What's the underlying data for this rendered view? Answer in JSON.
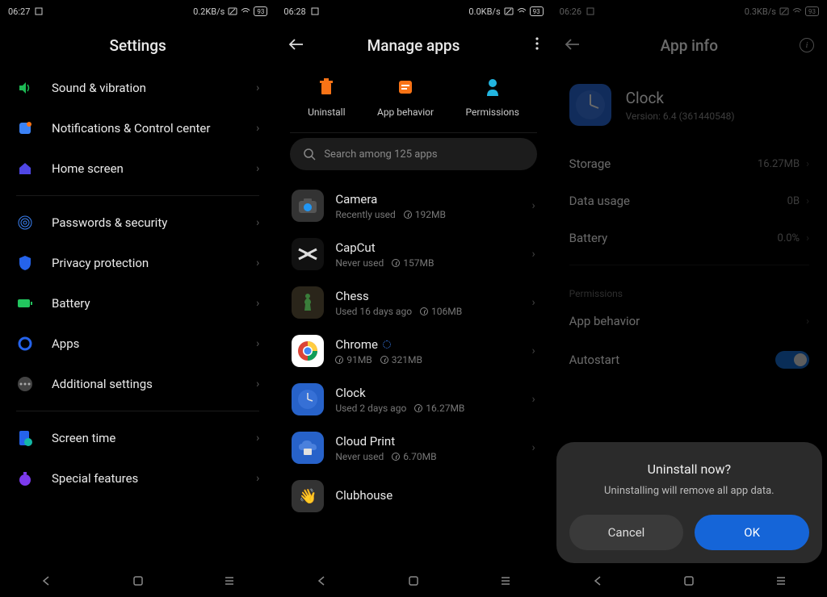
{
  "panel1": {
    "status": {
      "time": "06:27",
      "speed": "0.2KB/s",
      "battery": "93"
    },
    "title": "Settings",
    "items": [
      {
        "label": "Sound & vibration"
      },
      {
        "label": "Notifications & Control center"
      },
      {
        "label": "Home screen"
      },
      {
        "label": "Passwords & security"
      },
      {
        "label": "Privacy protection"
      },
      {
        "label": "Battery"
      },
      {
        "label": "Apps"
      },
      {
        "label": "Additional settings"
      },
      {
        "label": "Screen time"
      },
      {
        "label": "Special features"
      }
    ]
  },
  "panel2": {
    "status": {
      "time": "06:28",
      "speed": "0.0KB/s",
      "battery": "93"
    },
    "title": "Manage apps",
    "actions": {
      "uninstall": "Uninstall",
      "behavior": "App behavior",
      "permissions": "Permissions"
    },
    "search_placeholder": "Search among 125 apps",
    "apps": [
      {
        "name": "Camera",
        "sub": "Recently used",
        "size": "192MB"
      },
      {
        "name": "CapCut",
        "sub": "Never used",
        "size": "157MB"
      },
      {
        "name": "Chess",
        "sub": "Used 16 days ago",
        "size": "106MB"
      },
      {
        "name": "Chrome",
        "sub": "91MB",
        "size": "321MB",
        "loading": true,
        "alt_sub_is_size": true
      },
      {
        "name": "Clock",
        "sub": "Used 2 days ago",
        "size": "16.27MB"
      },
      {
        "name": "Cloud Print",
        "sub": "Never used",
        "size": "6.70MB"
      },
      {
        "name": "Clubhouse",
        "sub": "",
        "size": ""
      }
    ]
  },
  "panel3": {
    "status": {
      "time": "06:26",
      "speed": "0.3KB/s",
      "battery": "93"
    },
    "title": "App info",
    "app": {
      "name": "Clock",
      "version": "Version: 6.4 (361440548)"
    },
    "rows": {
      "storage_label": "Storage",
      "storage_val": "16.27MB",
      "data_label": "Data usage",
      "data_val": "0B",
      "battery_label": "Battery",
      "battery_val": "0.0%"
    },
    "perm_section": "Permissions",
    "behavior_label": "App behavior",
    "autostart_label": "Autostart",
    "dialog": {
      "title": "Uninstall now?",
      "message": "Uninstalling will remove all app data.",
      "cancel": "Cancel",
      "ok": "OK"
    }
  }
}
